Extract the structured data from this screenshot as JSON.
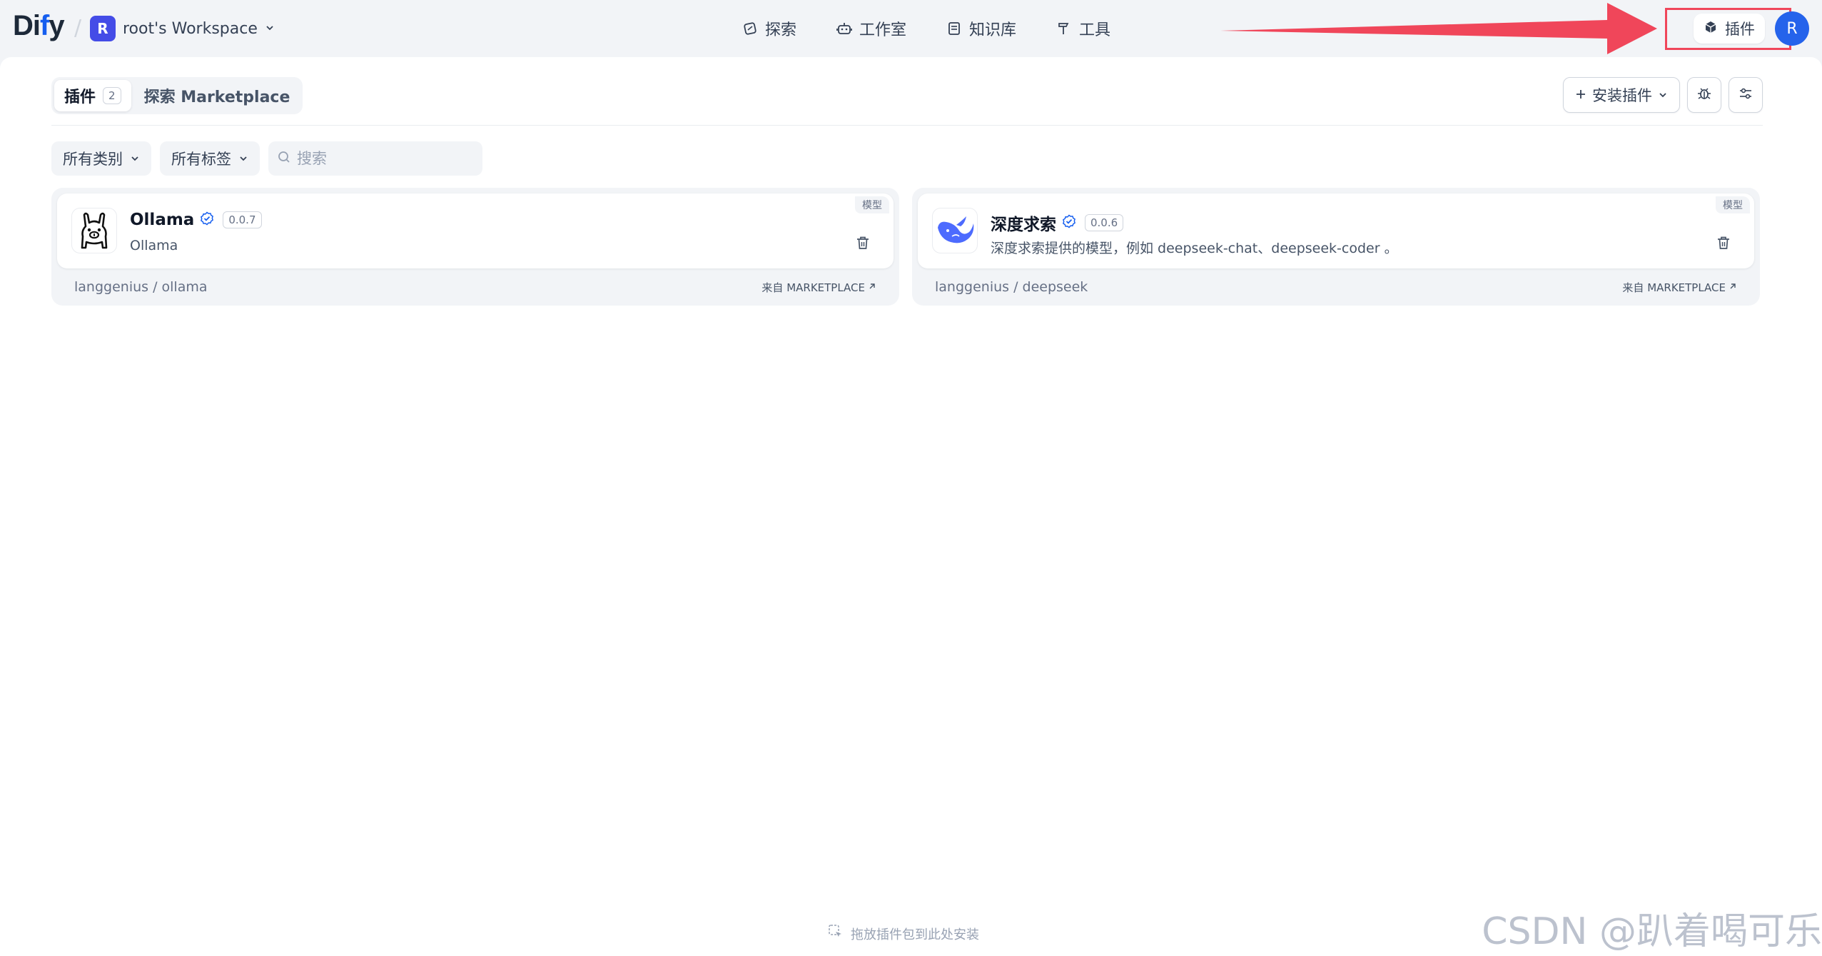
{
  "header": {
    "logo_main": "Di",
    "logo_accent": "f",
    "logo_end": "y",
    "workspace_initial": "R",
    "workspace_name": "root's Workspace",
    "nav": [
      {
        "label": "探索",
        "icon": "explore-icon"
      },
      {
        "label": "工作室",
        "icon": "robot-icon"
      },
      {
        "label": "知识库",
        "icon": "book-icon"
      },
      {
        "label": "工具",
        "icon": "hammer-icon"
      }
    ],
    "plugins_label": "插件",
    "avatar_initial": "R"
  },
  "tabs": [
    {
      "label": "插件",
      "count": "2",
      "active": true
    },
    {
      "label": "探索 Marketplace",
      "active": false
    }
  ],
  "actions": {
    "install_label": "安装插件"
  },
  "filters": {
    "category": "所有类别",
    "tags": "所有标签",
    "search_placeholder": "搜索"
  },
  "plugins": [
    {
      "name": "Ollama",
      "version": "0.0.7",
      "description": "Ollama",
      "tag": "模型",
      "org": "langgenius",
      "slug": "ollama",
      "source": "来自 MARKETPLACE"
    },
    {
      "name": "深度求索",
      "version": "0.0.6",
      "description": "深度求索提供的模型，例如 deepseek-chat、deepseek-coder 。",
      "tag": "模型",
      "org": "langgenius",
      "slug": "deepseek",
      "source": "来自 MARKETPLACE"
    }
  ],
  "drop_hint": "拖放插件包到此处安装",
  "watermark": "CSDN @趴着喝可乐",
  "colors": {
    "accent": "#155eef",
    "highlight": "#f0465a",
    "avatar": "#2563eb"
  }
}
